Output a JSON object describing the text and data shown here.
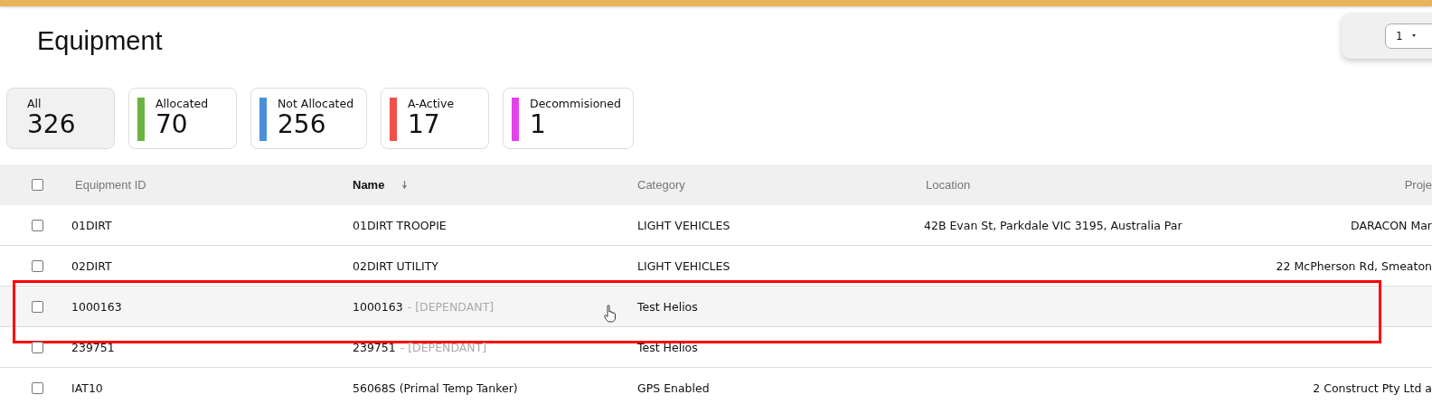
{
  "title": "Equipment",
  "pagination": {
    "page": "1"
  },
  "filters": [
    {
      "label": "All",
      "count": "326",
      "selected": true
    },
    {
      "label": "Allocated",
      "count": "70",
      "selected": false,
      "color": "#6db33f"
    },
    {
      "label": "Not Allocated",
      "count": "256",
      "selected": false,
      "color": "#4a90d9"
    },
    {
      "label": "A-Active",
      "count": "17",
      "selected": false,
      "color": "#f0504a"
    },
    {
      "label": "Decommisioned",
      "count": "1",
      "selected": false,
      "color": "#e044e8"
    }
  ],
  "table": {
    "select_all": {
      "checked": false
    },
    "columns": [
      {
        "label": "Equipment ID",
        "sorted": false
      },
      {
        "label": "Name",
        "sorted": true
      },
      {
        "label": "Category",
        "sorted": false
      },
      {
        "label": "Location",
        "sorted": false
      },
      {
        "label": "Proje",
        "sorted": false
      }
    ],
    "rows": [
      {
        "checked": false,
        "hovered": false,
        "highlighted": false,
        "id": "01DIRT",
        "name": "01DIRT TROOPIE",
        "category": "LIGHT VEHICLES",
        "location": "42B Evan St, Parkdale VIC 3195, Australia Par",
        "project": "DARACON Mar"
      },
      {
        "checked": false,
        "hovered": false,
        "highlighted": false,
        "id": "02DIRT",
        "name": "02DIRT UTILITY",
        "category": "LIGHT VEHICLES",
        "project": "22 McPherson Rd, Smeaton"
      },
      {
        "checked": false,
        "hovered": true,
        "highlighted": true,
        "id": "1000163",
        "name": "1000163",
        "name_suffix": "- [DEPENDANT]",
        "category": "Test Helios"
      },
      {
        "checked": false,
        "hovered": false,
        "highlighted": false,
        "id": "239751",
        "name": "239751",
        "name_suffix": "- [DEPENDANT]",
        "category": "Test Helios"
      },
      {
        "checked": false,
        "hovered": false,
        "highlighted": false,
        "id": "IAT10",
        "name": "56068S (Primal Temp Tanker)",
        "category": "GPS Enabled",
        "project": "2 Construct Pty Ltd a"
      }
    ]
  }
}
